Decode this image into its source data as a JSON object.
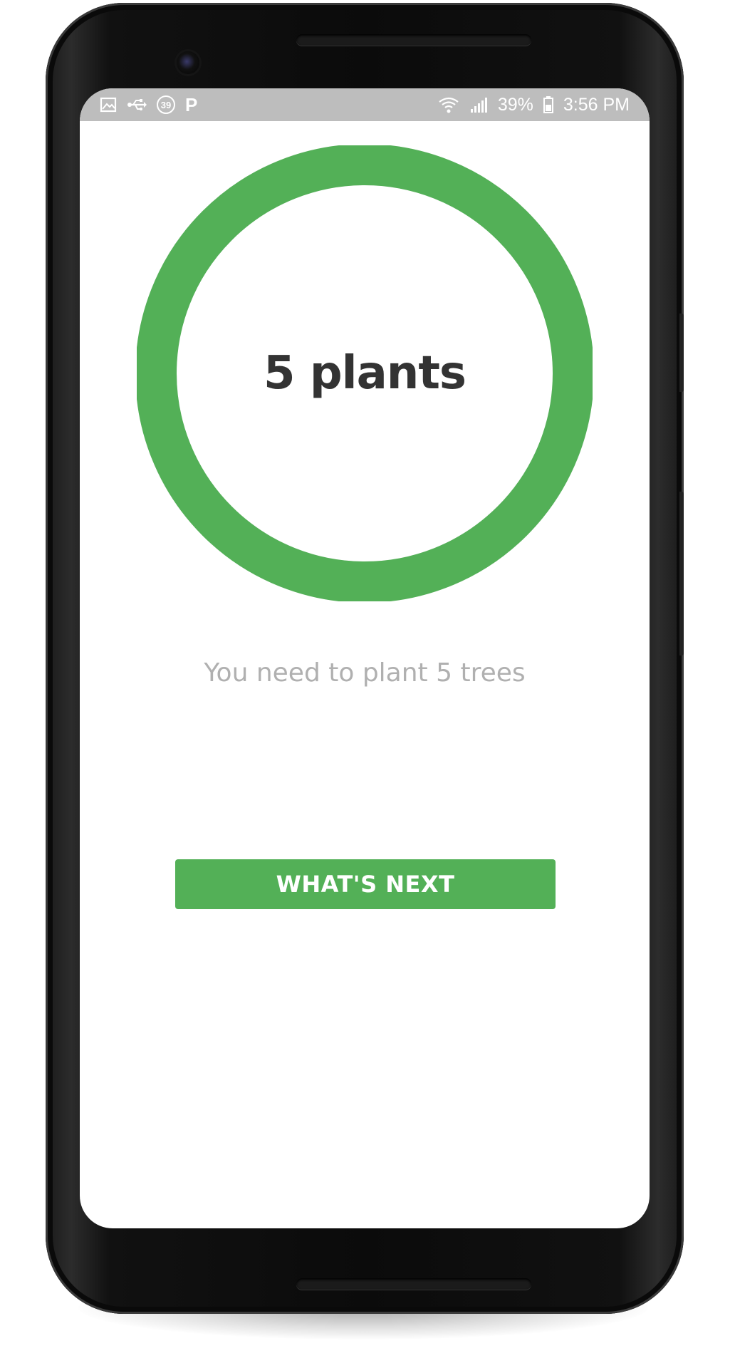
{
  "status_bar": {
    "left_icons": [
      "image-icon",
      "usb-icon",
      "badge-39-icon",
      "p-icon"
    ],
    "badge_text": "39",
    "p_text": "P",
    "right_icons": [
      "wifi-icon",
      "signal-icon",
      "battery-icon"
    ],
    "battery_percent": "39%",
    "time": "3:56 PM"
  },
  "progress": {
    "label": "5 plants",
    "fraction": 1.0,
    "ring_color": "#53b057"
  },
  "subtitle": "You need to plant 5 trees",
  "actions": {
    "next_label": "WHAT'S NEXT",
    "button_color": "#53b057"
  }
}
